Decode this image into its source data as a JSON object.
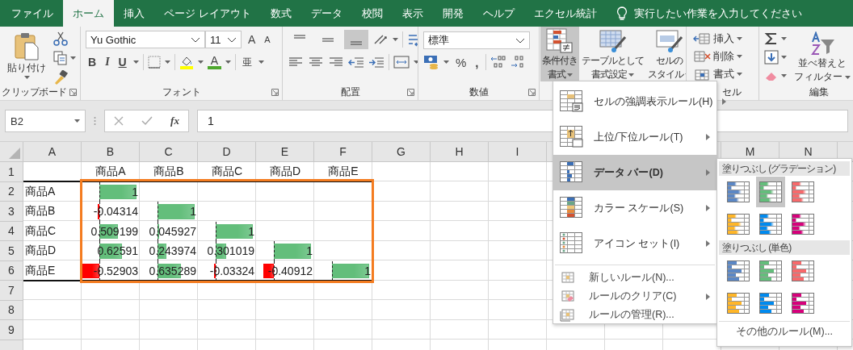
{
  "tabs": [
    {
      "label": "ファイル",
      "selected": false
    },
    {
      "label": "ホーム",
      "selected": true
    },
    {
      "label": "挿入",
      "selected": false
    },
    {
      "label": "ページ レイアウト",
      "selected": false
    },
    {
      "label": "数式",
      "selected": false
    },
    {
      "label": "データ",
      "selected": false
    },
    {
      "label": "校閲",
      "selected": false
    },
    {
      "label": "表示",
      "selected": false
    },
    {
      "label": "開発",
      "selected": false
    },
    {
      "label": "ヘルプ",
      "selected": false
    },
    {
      "label": "エクセル統計",
      "selected": false
    }
  ],
  "tell_me": {
    "placeholder": "実行したい作業を入力してください"
  },
  "ribbon": {
    "clipboard": {
      "paste": "貼り付け",
      "label": "クリップボード"
    },
    "font": {
      "font_name": "Yu Gothic",
      "font_size": "11",
      "grow": "A",
      "shrink": "A",
      "bold": "B",
      "italic": "I",
      "underline": "U",
      "font_color": "A",
      "phonetic": "亜",
      "label": "フォント"
    },
    "alignment": {
      "vertical": [
        {
          "selected": false
        },
        {
          "selected": false
        },
        {
          "selected": true
        }
      ],
      "label": "配置"
    },
    "number": {
      "format": "標準",
      "percent": "%",
      "comma": ",",
      "label": "数値"
    },
    "styles": {
      "buttons": [
        {
          "lines": [
            "条件付き",
            "書式"
          ],
          "expanded": true
        },
        {
          "lines": [
            "テーブルとして",
            "書式設定"
          ],
          "expanded": false
        },
        {
          "lines": [
            "セルの",
            "スタイル"
          ],
          "expanded": false
        }
      ]
    },
    "cells": {
      "buttons": [
        "挿入",
        "削除",
        "書式"
      ],
      "label": "セル"
    },
    "editing": {
      "sort_filter": [
        "並べ替えと",
        "フィルター"
      ],
      "label": "編集"
    }
  },
  "formula_bar": {
    "name_box": "B2",
    "fx": "fx",
    "value": "1"
  },
  "sheet": {
    "columns": [
      "A",
      "B",
      "C",
      "D",
      "E",
      "F",
      "G",
      "H",
      "I"
    ],
    "right_columns": [
      "M",
      "N"
    ],
    "row_numbers": [
      "1",
      "2",
      "3",
      "4",
      "5",
      "6",
      "7",
      "8",
      "9"
    ],
    "header_row": [
      "商品A",
      "商品B",
      "商品C",
      "商品D",
      "商品E"
    ],
    "data_rows": [
      {
        "label": "商品A",
        "cells": [
          {
            "text": "1",
            "level": 0.95,
            "negative": false
          }
        ]
      },
      {
        "label": "商品B",
        "cells": [
          {
            "text": "-0.04314",
            "level": 0.1,
            "negative": true
          },
          {
            "text": "1",
            "level": 0.95,
            "negative": false
          }
        ]
      },
      {
        "label": "商品C",
        "cells": [
          {
            "text": "0.509199",
            "level": 0.48,
            "negative": false
          },
          {
            "text": "0.045927",
            "level": 0.05,
            "negative": false
          },
          {
            "text": "1",
            "level": 0.95,
            "negative": false
          }
        ]
      },
      {
        "label": "商品D",
        "cells": [
          {
            "text": "0.62591",
            "level": 0.59,
            "negative": false
          },
          {
            "text": "0.243974",
            "level": 0.22,
            "negative": false
          },
          {
            "text": "0.301019",
            "level": 0.28,
            "negative": false
          },
          {
            "text": "1",
            "level": 0.95,
            "negative": false
          }
        ]
      },
      {
        "label": "商品E",
        "cells": [
          {
            "text": "-0.52903",
            "level": 1,
            "negative": true
          },
          {
            "text": "0.635289",
            "level": 0.6,
            "negative": false
          },
          {
            "text": "-0.03324",
            "level": 0.1,
            "negative": true
          },
          {
            "text": "-0.40912",
            "level": 0.6,
            "negative": true
          },
          {
            "text": "1",
            "level": 0.95,
            "negative": false
          }
        ]
      }
    ]
  },
  "menu": {
    "items": [
      {
        "label": "セルの強調表示ルール(H)",
        "selected": false
      },
      {
        "label": "上位/下位ルール(T)",
        "selected": false
      },
      {
        "label": "データ バー(D)",
        "selected": true
      },
      {
        "label": "カラー スケール(S)",
        "selected": false
      },
      {
        "label": "アイコン セット(I)",
        "selected": false
      }
    ],
    "small_items": [
      {
        "label": "新しいルール(N)...",
        "submenu": false
      },
      {
        "label": "ルールのクリア(C)",
        "submenu": true
      },
      {
        "label": "ルールの管理(R)...",
        "submenu": false
      }
    ]
  },
  "submenu": {
    "sections": [
      {
        "title": "塗りつぶし (グラデーション)",
        "kind": "gradient",
        "swatches": [
          {
            "color": "#5b87c5",
            "selected": false
          },
          {
            "color": "#63be7b",
            "selected": true
          },
          {
            "color": "#f8696b",
            "selected": false
          },
          {
            "color": "#ffb628",
            "selected": false
          },
          {
            "color": "#008aef",
            "selected": false
          },
          {
            "color": "#d6007b",
            "selected": false
          }
        ]
      },
      {
        "title": "塗りつぶし (単色)",
        "kind": "solid",
        "swatches": [
          {
            "color": "#5b87c5",
            "selected": false
          },
          {
            "color": "#63be7b",
            "selected": false
          },
          {
            "color": "#f8696b",
            "selected": false
          },
          {
            "color": "#ffb628",
            "selected": false
          },
          {
            "color": "#008aef",
            "selected": false
          },
          {
            "color": "#d6007b",
            "selected": false
          }
        ]
      }
    ],
    "more": "その他のルール(M)..."
  }
}
